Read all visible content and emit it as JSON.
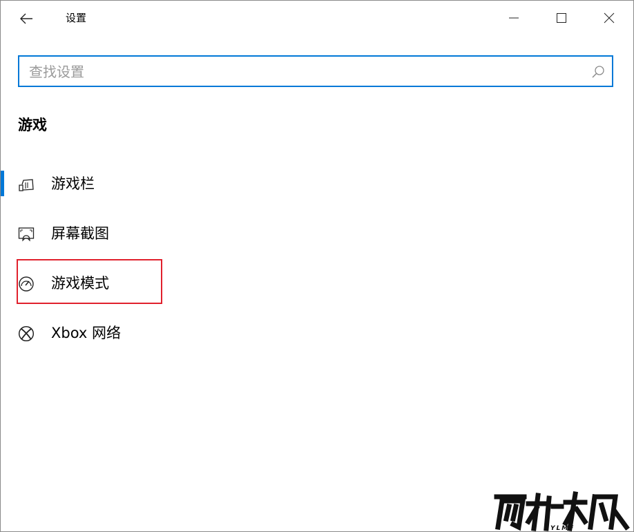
{
  "window": {
    "title": "设置"
  },
  "search": {
    "placeholder": "查找设置",
    "value": ""
  },
  "section": {
    "title": "游戏"
  },
  "nav": {
    "items": [
      {
        "label": "游戏栏",
        "icon": "game-bar-icon",
        "selected": true
      },
      {
        "label": "屏幕截图",
        "icon": "screen-capture-icon",
        "selected": false
      },
      {
        "label": "游戏模式",
        "icon": "game-mode-icon",
        "selected": false
      },
      {
        "label": "Xbox 网络",
        "icon": "xbox-icon",
        "selected": false
      }
    ]
  },
  "colors": {
    "accent": "#0078d7",
    "highlight": "#e0202c"
  },
  "watermark": {
    "brand": "雨林木风",
    "sub": "YLMF"
  }
}
